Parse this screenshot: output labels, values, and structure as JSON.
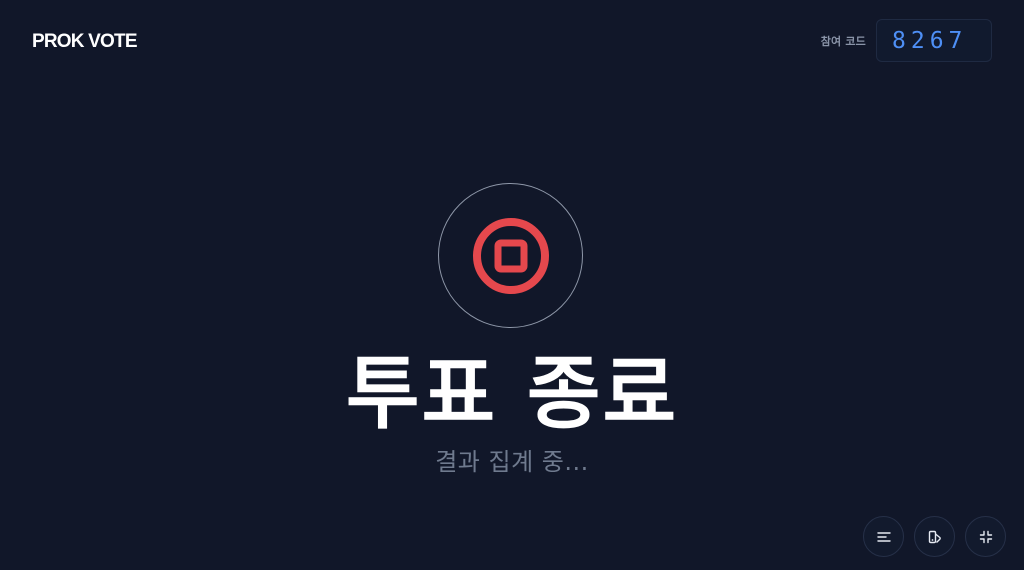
{
  "header": {
    "logo": "PROK VOTE",
    "code_label": "참여 코드",
    "code": "8267"
  },
  "status": {
    "icon": "stop-circle-icon",
    "title": "투표 종료",
    "subtitle": "결과 집계 중..."
  },
  "controls": [
    {
      "name": "menu-icon"
    },
    {
      "name": "theme-icon"
    },
    {
      "name": "fullscreen-icon"
    }
  ],
  "colors": {
    "background": "#111729",
    "accent_blue": "#4e8ff5",
    "stop_red": "#e5484d",
    "muted_text": "#6f7a8e"
  }
}
